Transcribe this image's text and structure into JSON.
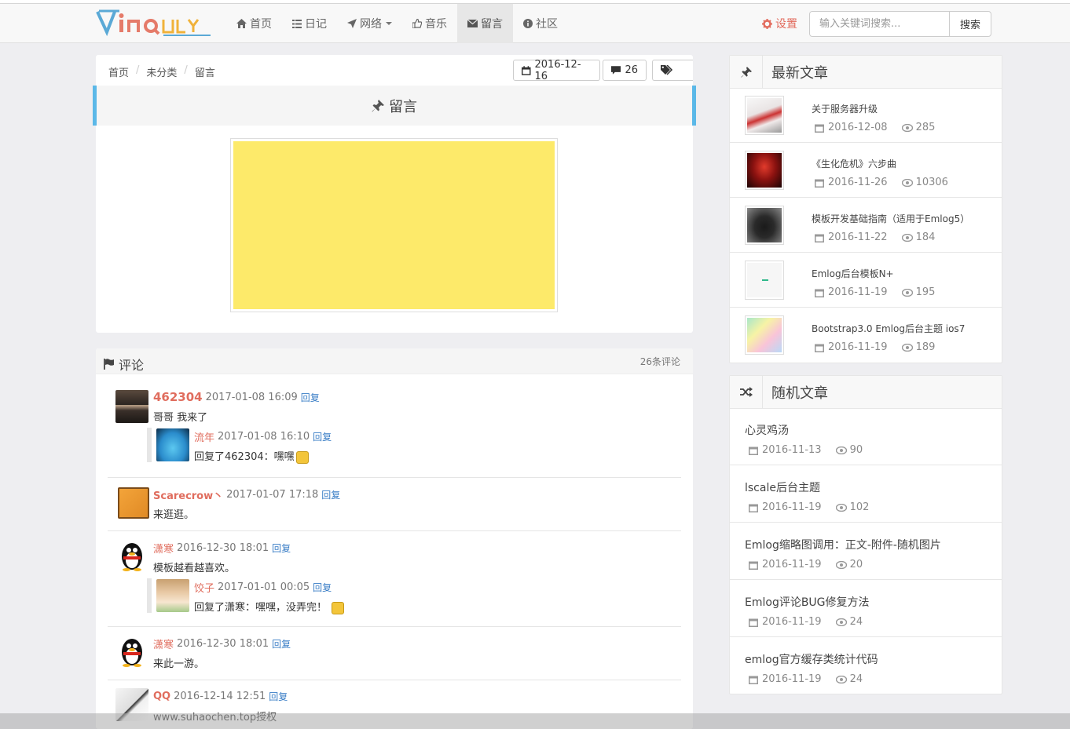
{
  "nav": {
    "logo_text": "Vinquan",
    "items": [
      {
        "label": "首页",
        "icon": "home-icon"
      },
      {
        "label": "日记",
        "icon": "list-icon"
      },
      {
        "label": "网络",
        "icon": "send-icon"
      },
      {
        "label": "音乐",
        "icon": "thumbs-up-icon"
      },
      {
        "label": "留言",
        "icon": "envelope-icon"
      },
      {
        "label": "社区",
        "icon": "info-icon"
      }
    ],
    "active_index": 4,
    "settings_label": "设置",
    "search_placeholder": "输入关键词搜索...",
    "search_button": "搜索"
  },
  "article": {
    "breadcrumb": [
      "首页",
      "未分类",
      "留言"
    ],
    "date": "2016-12-16",
    "comment_count": "26",
    "title": "留言"
  },
  "comments": {
    "title": "评论",
    "count_label": "26条评论",
    "reply_label": "回复",
    "items": [
      {
        "name": "462304",
        "time": "2017-01-08 16:09",
        "text": "哥哥 我来了",
        "child": {
          "name": "流年",
          "time": "2017-01-08 16:10",
          "text": "回复了462304：嘿嘿"
        }
      },
      {
        "name": "Scarecrow丶",
        "time": "2017-01-07 17:18",
        "text": "来逛逛。"
      },
      {
        "name": "潇寒",
        "time": "2016-12-30 18:01",
        "text": "模板越看越喜欢。",
        "child": {
          "name": "饺子",
          "time": "2017-01-01 00:05",
          "text": "回复了潇寒：嘿嘿，没弄完！"
        }
      },
      {
        "name": "潇寒",
        "time": "2016-12-30 18:01",
        "text": "来此一游。"
      },
      {
        "name": "QQ",
        "time": "2016-12-14 12:51",
        "text": "www.suhaochen.top授权"
      }
    ]
  },
  "recent": {
    "title": "最新文章",
    "items": [
      {
        "title": "关于服务器升级",
        "date": "2016-12-08",
        "views": "285"
      },
      {
        "title": "《生化危机》六步曲",
        "date": "2016-11-26",
        "views": "10306"
      },
      {
        "title": "模板开发基础指南（适用于Emlog5）",
        "date": "2016-11-22",
        "views": "184"
      },
      {
        "title": "Emlog后台模板N+",
        "date": "2016-11-19",
        "views": "195"
      },
      {
        "title": "Bootstrap3.0 Emlog后台主题 ios7",
        "date": "2016-11-19",
        "views": "189"
      }
    ]
  },
  "random": {
    "title": "随机文章",
    "items": [
      {
        "title": "心灵鸡汤",
        "date": "2016-11-13",
        "views": "90"
      },
      {
        "title": "lscale后台主题",
        "date": "2016-11-19",
        "views": "102"
      },
      {
        "title": "Emlog缩略图调用：正文-附件-随机图片",
        "date": "2016-11-19",
        "views": "20"
      },
      {
        "title": "Emlog评论BUG修复方法",
        "date": "2016-11-19",
        "views": "24"
      },
      {
        "title": "emlog官方缓存类统计代码",
        "date": "2016-11-19",
        "views": "24"
      }
    ]
  },
  "colors": {
    "accent": "#5bb8e8",
    "name": "#e06d5e",
    "link": "#3a7ec6",
    "image": "#fdea6a"
  }
}
